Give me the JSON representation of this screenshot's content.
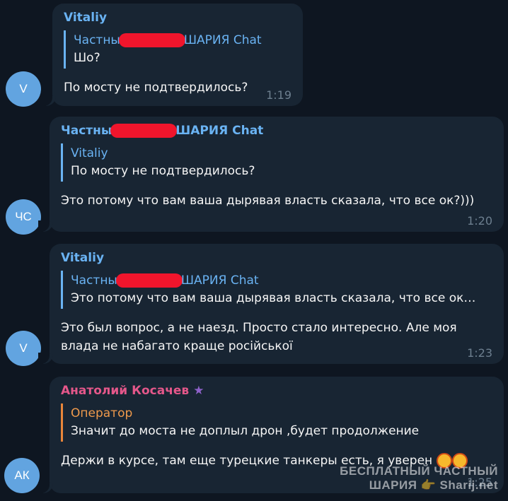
{
  "messages": [
    {
      "avatar_initials": "V",
      "author": "Vitaliy",
      "reply_author_start": "Частны",
      "reply_author_end": "ШАРИЯ Chat",
      "reply_text": "Шо?",
      "text": "По мосту не подтвердилось?",
      "time": "1:19"
    },
    {
      "avatar_initials": "ЧС",
      "author_start": "Частны",
      "author_end": "ШАРИЯ Chat",
      "reply_author": "Vitaliy",
      "reply_text": "По мосту не подтвердилось?",
      "text": "Это потому что вам ваша дырявая власть сказала, что все ок?)))",
      "time": "1:20"
    },
    {
      "avatar_initials": "V",
      "author": "Vitaliy",
      "reply_author_start": "Частны",
      "reply_author_end": "ШАРИЯ Chat",
      "reply_text": "Это потому что вам ваша дырявая власть сказала, что все ок…",
      "text_line1": "Это был вопрос, а не наезд. Просто стало интересно. Але моя",
      "text_line2": "влада не набагато краще російської",
      "time": "1:23"
    },
    {
      "avatar_initials": "АК",
      "author": "Анатолий Косачев",
      "reply_author": "Оператор",
      "reply_text": "Значит до моста не доплыл дрон ,будет продолжение",
      "text": "Держи в курсе, там еще турецкие танкеры есть, я уверен",
      "time": "1:25"
    }
  ],
  "watermark": {
    "line1": "БЕСПЛАТНЫЙ ЧАСТНЫЙ",
    "line2": "ШАРИЯ 👉 Sharij.net"
  },
  "colors": {
    "background": "#0e1621",
    "bubble": "#182533",
    "accent": "#6ab3f3",
    "redaction": "#f0152c",
    "avatar": "#62a4e0"
  }
}
